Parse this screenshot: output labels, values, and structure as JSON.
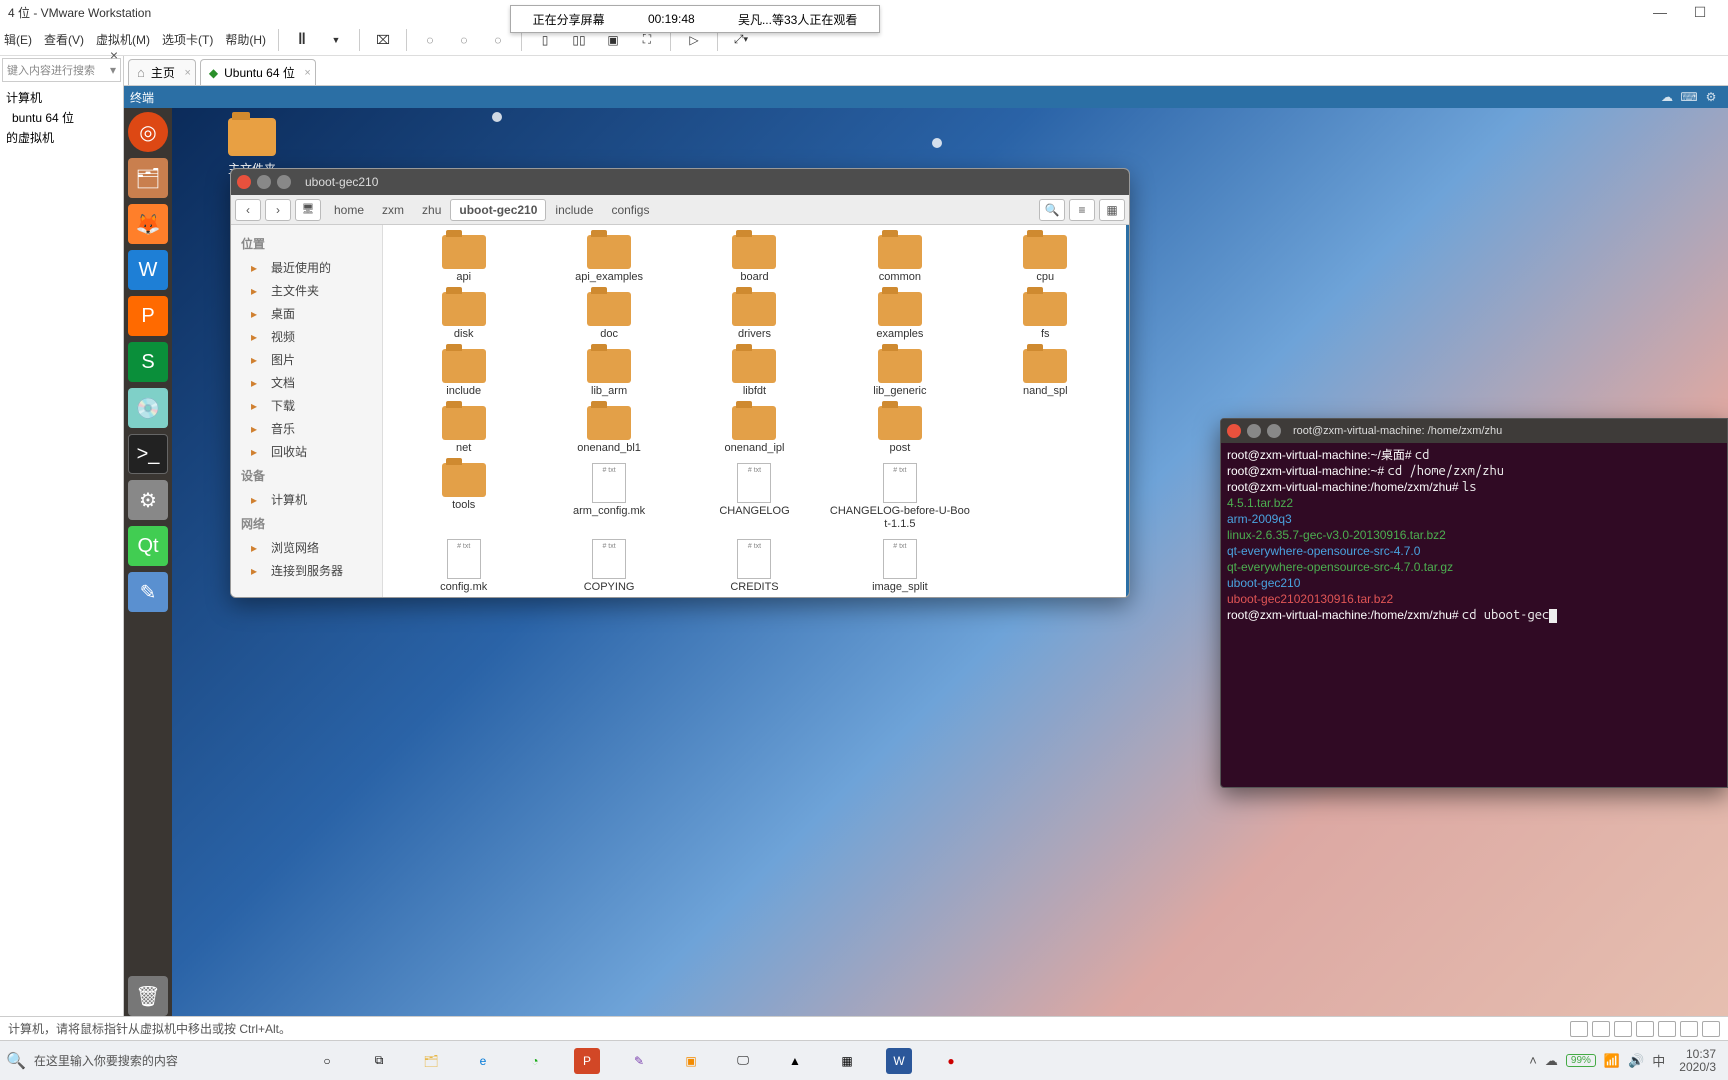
{
  "vmware": {
    "title_suffix": "4 位 - VMware Workstation",
    "menu": {
      "edit": "辑(E)",
      "view": "查看(V)",
      "vm": "虚拟机(M)",
      "tabs": "选项卡(T)",
      "help": "帮助(H)"
    },
    "left_panel": {
      "search_placeholder": "键入内容进行搜索",
      "tree": {
        "root": "计算机",
        "vm": "buntu 64 位",
        "mine": "的虚拟机"
      }
    },
    "tabs": {
      "home": "主页",
      "ubuntu": "Ubuntu 64 位"
    },
    "status": "计算机，请将鼠标指针从虚拟机中移出或按 Ctrl+Alt。"
  },
  "share": {
    "text": "正在分享屏幕",
    "time": "00:19:48",
    "watch": "吴凡...等33人正在观看"
  },
  "guest": {
    "titlebar": "终端",
    "desktop_folder": "主文件夹"
  },
  "nautilus": {
    "title": "uboot-gec210",
    "breadcrumb": [
      "home",
      "zxm",
      "zhu",
      "uboot-gec210",
      "include",
      "configs"
    ],
    "breadcrumb_active_index": 3,
    "sidebar": {
      "places": "位置",
      "items1": [
        "最近使用的",
        "主文件夹",
        "桌面",
        "视频",
        "图片",
        "文档",
        "下载",
        "音乐",
        "回收站"
      ],
      "devices": "设备",
      "items2": [
        "计算机"
      ],
      "network": "网络",
      "items3": [
        "浏览网络",
        "连接到服务器"
      ]
    },
    "grid": [
      {
        "n": "api",
        "t": "f"
      },
      {
        "n": "api_examples",
        "t": "f"
      },
      {
        "n": "board",
        "t": "f"
      },
      {
        "n": "common",
        "t": "f"
      },
      {
        "n": "cpu",
        "t": "f"
      },
      {
        "n": "disk",
        "t": "f"
      },
      {
        "n": "doc",
        "t": "f"
      },
      {
        "n": "drivers",
        "t": "f"
      },
      {
        "n": "examples",
        "t": "f"
      },
      {
        "n": "fs",
        "t": "f"
      },
      {
        "n": "include",
        "t": "f"
      },
      {
        "n": "lib_arm",
        "t": "f"
      },
      {
        "n": "libfdt",
        "t": "f"
      },
      {
        "n": "lib_generic",
        "t": "f"
      },
      {
        "n": "nand_spl",
        "t": "f"
      },
      {
        "n": "net",
        "t": "f"
      },
      {
        "n": "onenand_bl1",
        "t": "f"
      },
      {
        "n": "onenand_ipl",
        "t": "f"
      },
      {
        "n": "post",
        "t": "f"
      },
      {
        "n": "",
        "t": ""
      },
      {
        "n": "tools",
        "t": "f"
      },
      {
        "n": "arm_config.mk",
        "t": "d"
      },
      {
        "n": "CHANGELOG",
        "t": "d"
      },
      {
        "n": "CHANGELOG-before-U-Boot-1.1.5",
        "t": "d"
      },
      {
        "n": "",
        "t": ""
      },
      {
        "n": "config.mk",
        "t": "d"
      },
      {
        "n": "COPYING",
        "t": "d"
      },
      {
        "n": "CREDITS",
        "t": "d"
      },
      {
        "n": "image_split",
        "t": "d"
      },
      {
        "n": "",
        "t": ""
      }
    ]
  },
  "terminal": {
    "title": "root@zxm-virtual-machine: /home/zxm/zhu",
    "lines": [
      {
        "pr": "root@zxm-virtual-machine:~/桌面# ",
        "cmd": "cd"
      },
      {
        "pr": "root@zxm-virtual-machine:~# ",
        "cmd": "cd /home/zxm/zhu"
      },
      {
        "pr": "root@zxm-virtual-machine:/home/zxm/zhu# ",
        "cmd": "ls"
      }
    ],
    "ls": [
      {
        "c": "gr",
        "t": "4.5.1.tar.bz2"
      },
      {
        "c": "bl",
        "t": "arm-2009q3"
      },
      {
        "c": "gr",
        "t": "linux-2.6.35.7-gec-v3.0-20130916.tar.bz2"
      },
      {
        "c": "bl",
        "t": "qt-everywhere-opensource-src-4.7.0"
      },
      {
        "c": "gr",
        "t": "qt-everywhere-opensource-src-4.7.0.tar.gz"
      },
      {
        "c": "bl",
        "t": "uboot-gec210"
      },
      {
        "c": "rd",
        "t": "uboot-gec21020130916.tar.bz2"
      }
    ],
    "cur_prompt": "root@zxm-virtual-machine:/home/zxm/zhu# ",
    "cur_cmd": "cd uboot-gec"
  },
  "taskbar": {
    "search": "在这里输入你要搜索的内容",
    "battery": "99%",
    "ime": "中",
    "clock": {
      "time": "10:37",
      "date": "2020/3"
    }
  }
}
